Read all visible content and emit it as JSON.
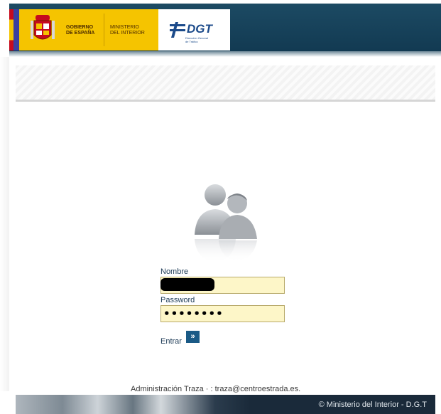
{
  "header": {
    "gobierno_line1": "GOBIERNO",
    "gobierno_line2": "DE ESPAÑA",
    "ministerio_line1": "MINISTERIO",
    "ministerio_line2": "DEL INTERIOR",
    "dgt_logo": "DGT",
    "dgt_sub1": "Dirección General",
    "dgt_sub2": "de Tráfico"
  },
  "login": {
    "username_label": "Nombre",
    "username_value": "",
    "password_label": "Password",
    "password_value": "••••••••",
    "submit_label": "Entrar",
    "submit_icon": "»"
  },
  "footer": {
    "admin_text": "Administración Traza · : traza@centroestrada.es.",
    "copyright": "© Ministerio del Interior - D.G.T"
  },
  "colors": {
    "header_bg": "#123a52",
    "gov_yellow": "#f5c400",
    "field_bg": "#fdf6c8",
    "button_bg": "#1a5a86"
  }
}
